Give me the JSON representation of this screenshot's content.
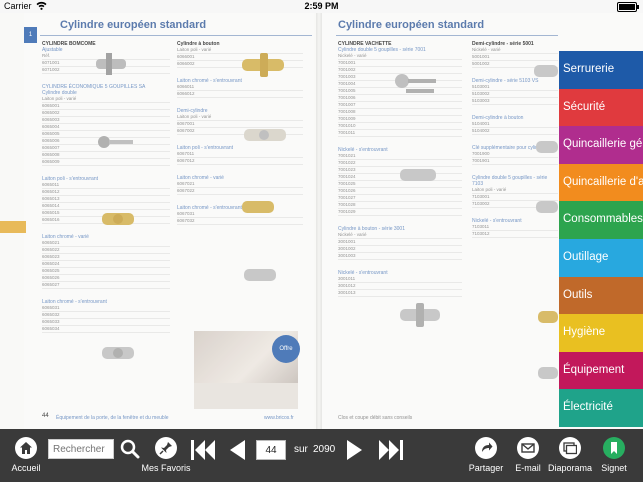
{
  "status_bar": {
    "carrier": "Carrier",
    "wifi_icon": "wifi-icon",
    "time": "2:59 PM",
    "battery_label": ""
  },
  "catalog": {
    "left_title": "Cylindre européen standard",
    "right_title": "Cylindre européen standard",
    "left_tab": "1",
    "left_page_number": "44",
    "right_footer_left": "Clos et coupe débit sans conseils",
    "left_footer": "Équipement de la porte, de la fenêtre et du meuble",
    "left_footer_link": "www.bricos.fr",
    "promo_badge": "Offre",
    "sections_left_col1": [
      {
        "title": "CYLINDRE BOMCOME",
        "subtitle": "Ajustable",
        "rows": [
          "Réf.",
          "6071001",
          "6071002"
        ]
      },
      {
        "title": "CYLINDRE ÉCONOMIQUE 5 GOUPILLES SA",
        "subtitle": "Cylindre double",
        "rows": [
          "Laiton poli - varié",
          "6065001",
          "6065002",
          "6065003",
          "6065004",
          "6065005",
          "6065006",
          "6065007",
          "6065008",
          "6065009"
        ]
      },
      {
        "title": "Laiton poli - s'entrouvrant",
        "subtitle": "",
        "rows": [
          "6065011",
          "6065012",
          "6065013",
          "6065014",
          "6065015",
          "6065016"
        ]
      },
      {
        "title": "Laiton chromé - varié",
        "subtitle": "",
        "rows": [
          "6065021",
          "6065022",
          "6065023",
          "6065024",
          "6065025",
          "6065026",
          "6065027"
        ]
      },
      {
        "title": "Laiton chromé - s'entrouvrant",
        "subtitle": "",
        "rows": [
          "6065031",
          "6065032",
          "6065033",
          "6065034"
        ]
      }
    ],
    "sections_left_col2": [
      {
        "title": "Cylindre à bouton",
        "rows": [
          "Laiton poli - varié",
          "6066001",
          "6066002"
        ]
      },
      {
        "title": "Laiton chromé - s'entrouvrant",
        "rows": [
          "6066011",
          "6066012"
        ]
      },
      {
        "title": "Demi-cylindre",
        "rows": [
          "Laiton poli - varié",
          "6067001",
          "6067002"
        ]
      },
      {
        "title": "Laiton poli - s'entrouvrant",
        "rows": [
          "6067011",
          "6067012"
        ]
      },
      {
        "title": "Laiton chromé - varié",
        "rows": [
          "6067021",
          "6067022"
        ]
      },
      {
        "title": "Laiton chromé - s'entrouvrant",
        "rows": [
          "6067031",
          "6067032"
        ]
      }
    ],
    "sections_right_col1": [
      {
        "title": "CYLINDRE VACHETTE",
        "subtitle": "Cylindre double 5 goupilles - série 7001",
        "rows": [
          "Nickelé - varié",
          "7001001",
          "7001002",
          "7001003",
          "7001004",
          "7001005",
          "7001006",
          "7001007",
          "7001008",
          "7001009",
          "7001010",
          "7001011"
        ]
      },
      {
        "title": "Nickelé - s'entrouvrant",
        "subtitle": "",
        "rows": [
          "7001021",
          "7001022",
          "7001023",
          "7001024",
          "7001025",
          "7001026",
          "7001027",
          "7001028",
          "7001029"
        ]
      },
      {
        "title": "Cylindre à bouton - série 3001",
        "subtitle": "",
        "rows": [
          "Nickelé - varié",
          "3001001",
          "3001002",
          "3001003"
        ]
      },
      {
        "title": "Nickelé - s'entrouvrant",
        "subtitle": "",
        "rows": [
          "3001011",
          "3001012",
          "3001013"
        ]
      }
    ],
    "sections_right_col2": [
      {
        "title": "Demi-cylindre - série 5001",
        "rows": [
          "Nickelé - varié",
          "5001001",
          "5001002"
        ]
      },
      {
        "title": "Demi-cylindre - série 5103 VS",
        "rows": [
          "5103001",
          "5103002",
          "5103003"
        ]
      },
      {
        "title": "Demi-cylindre à bouton",
        "rows": [
          "5104001",
          "5104002"
        ]
      },
      {
        "title": "Clé supplémentaire pour cylindre série",
        "rows": [
          "7001900",
          "7001901"
        ]
      },
      {
        "title": "Cylindre double 5 goupilles - série 7103",
        "rows": [
          "Laiton poli - varié",
          "7103001",
          "7103002"
        ]
      },
      {
        "title": "Nickelé - s'entrouvrant",
        "rows": [
          "7103011",
          "7103012"
        ]
      }
    ]
  },
  "categories": [
    {
      "label": "Serrurerie",
      "color": "#1e5aa8"
    },
    {
      "label": "Sécurité",
      "color": "#e03a3e"
    },
    {
      "label": "Quincaillerie générale",
      "color": "#b02d8e"
    },
    {
      "label": "Quincaillerie d'agencement",
      "color": "#f28c1e"
    },
    {
      "label": "Consommables",
      "color": "#2da44e"
    },
    {
      "label": "Outillage",
      "color": "#28a8df"
    },
    {
      "label": "Outils",
      "color": "#c0692a"
    },
    {
      "label": "Hygiène",
      "color": "#e9c021"
    },
    {
      "label": "Équipement",
      "color": "#c2185b"
    },
    {
      "label": "Électricité",
      "color": "#1fa38a"
    }
  ],
  "toolbar": {
    "home_label": "Accueil",
    "search_placeholder": "Rechercher",
    "favorites_label": "Mes Favoris",
    "page_value": "44",
    "sur_label": "sur",
    "total_pages": "2090",
    "share_label": "Partager",
    "email_label": "E-mail",
    "slideshow_label": "Diaporama",
    "bookmark_label": "Signet"
  }
}
